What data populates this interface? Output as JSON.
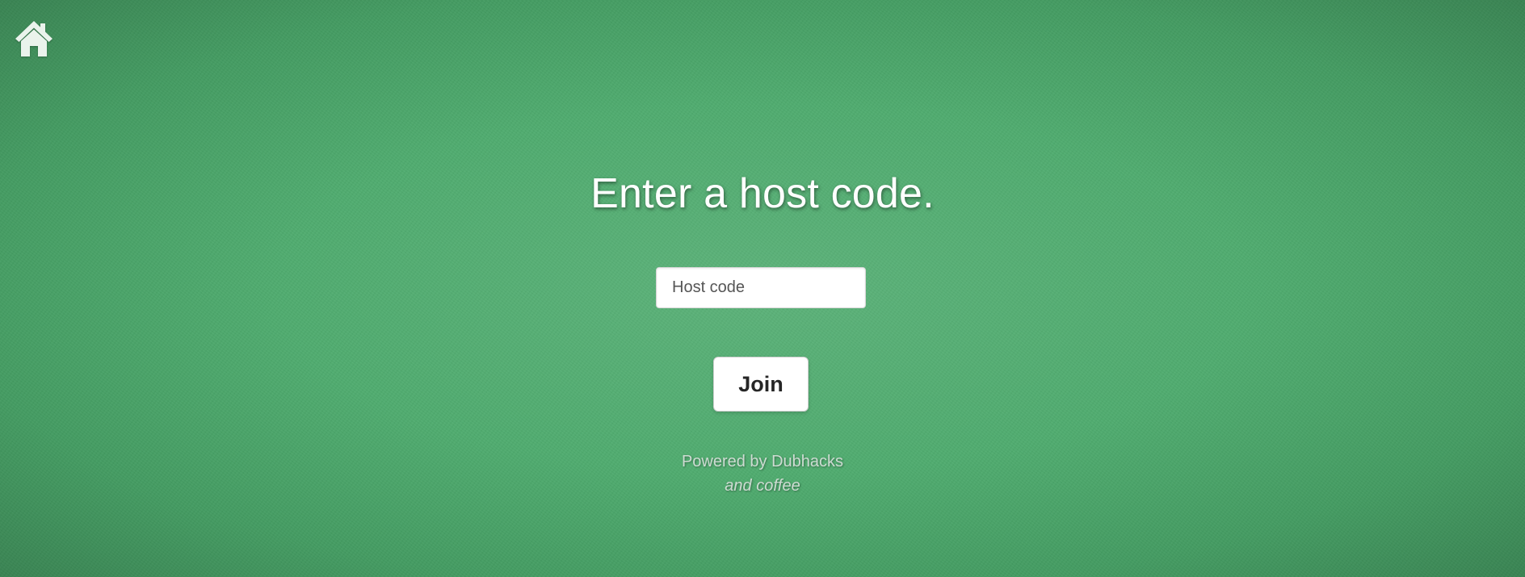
{
  "nav": {
    "home_icon": "home-icon",
    "home_icon_color": "#eaf3ec"
  },
  "main": {
    "title": "Enter a host code.",
    "host_code_input": {
      "placeholder": "Host code",
      "value": ""
    },
    "join_label": "Join"
  },
  "footer": {
    "line1": "Powered by Dubhacks",
    "line2": "and coffee"
  },
  "colors": {
    "background": "#49a96a",
    "text_primary": "#ffffff",
    "button_text": "#262626"
  }
}
